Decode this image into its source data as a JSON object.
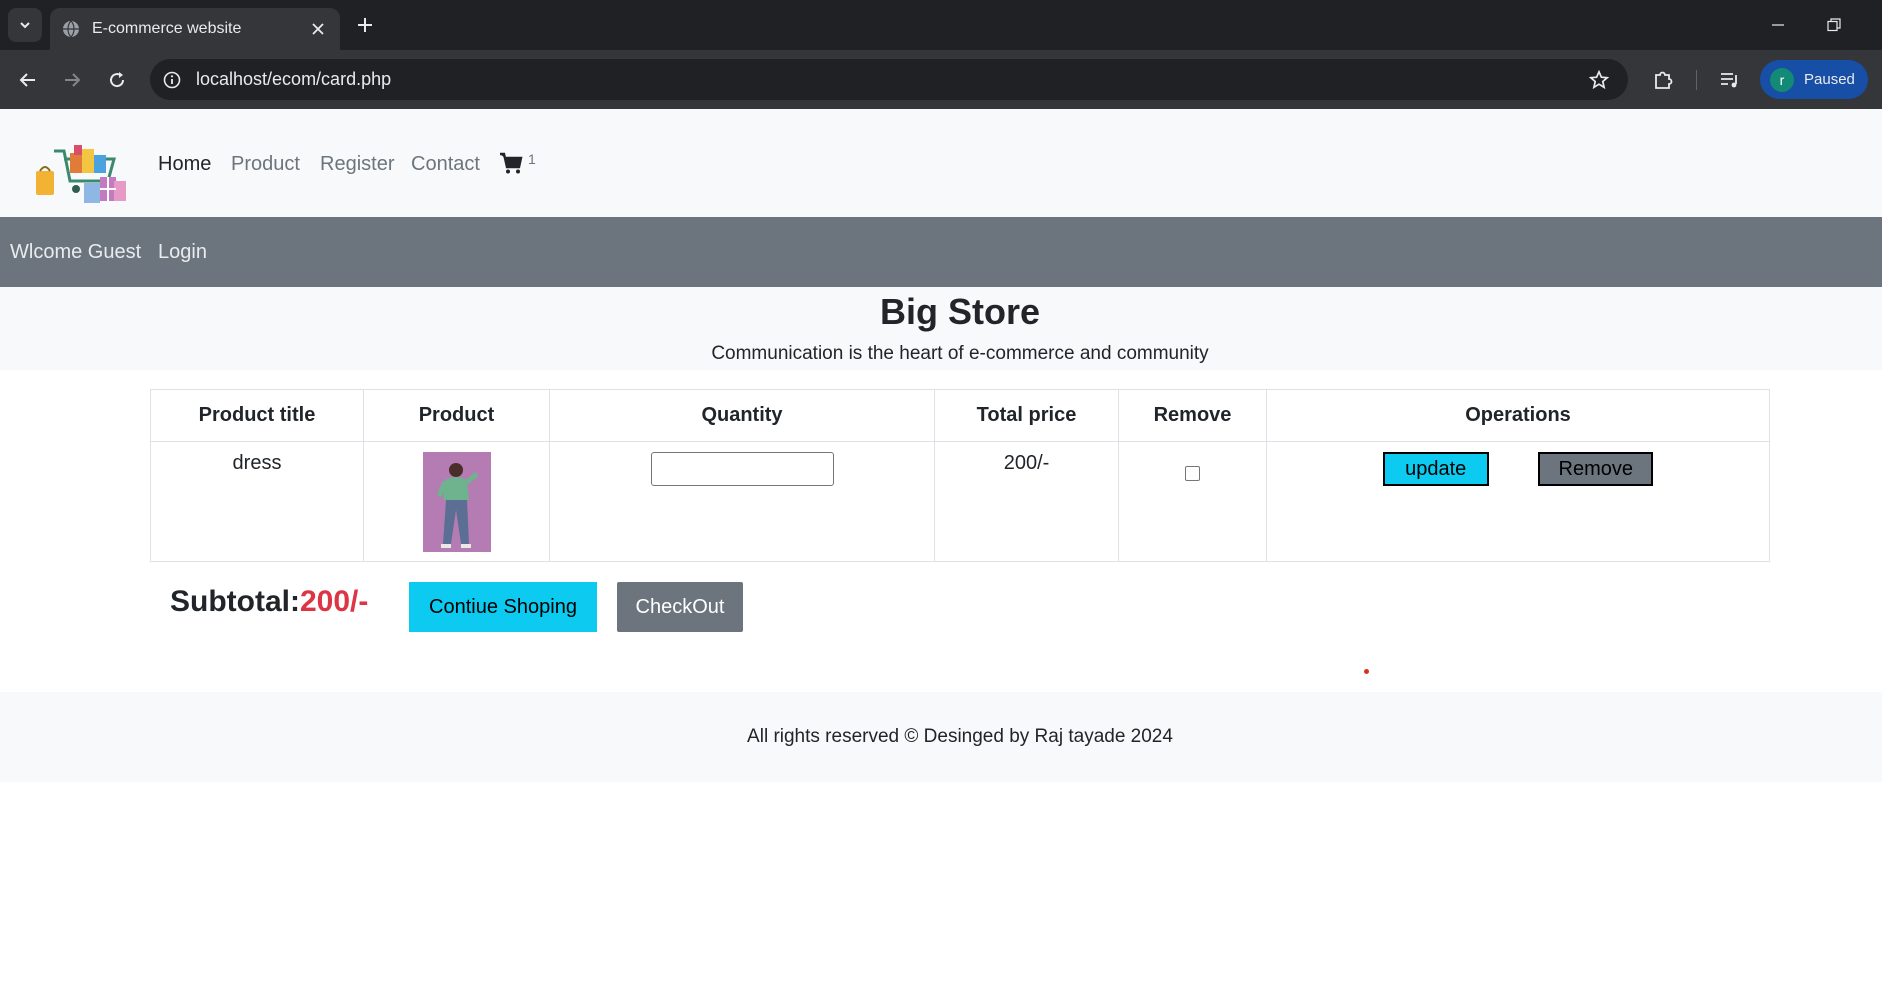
{
  "browser": {
    "tab_title": "E-commerce website",
    "url": "localhost/ecom/card.php",
    "profile_initial": "r",
    "profile_status": "Paused"
  },
  "nav": {
    "links": [
      "Home",
      "Product",
      "Register",
      "Contact"
    ],
    "cart_count": "1"
  },
  "subnav": {
    "welcome": "Wlcome Guest",
    "login": "Login"
  },
  "hero": {
    "title": "Big Store",
    "tagline": "Communication is the heart of e-commerce and community"
  },
  "cart_table": {
    "headers": [
      "Product title",
      "Product",
      "Quantity",
      "Total price",
      "Remove",
      "Operations"
    ],
    "rows": [
      {
        "title": "dress",
        "quantity": "",
        "total_price": "200/-",
        "remove_checked": false
      }
    ],
    "update_label": "update",
    "remove_label": "Remove"
  },
  "summary": {
    "subtotal_label": "Subtotal:",
    "subtotal_value": "200/-",
    "continue_label": "Contiue Shoping",
    "checkout_label": "CheckOut"
  },
  "footer": {
    "text": "All rights reserved © Desinged by Raj tayade 2024"
  },
  "colors": {
    "info": "#0dcaf0",
    "secondary": "#6c757d",
    "danger": "#dc3545",
    "light": "#f8f9fa"
  }
}
